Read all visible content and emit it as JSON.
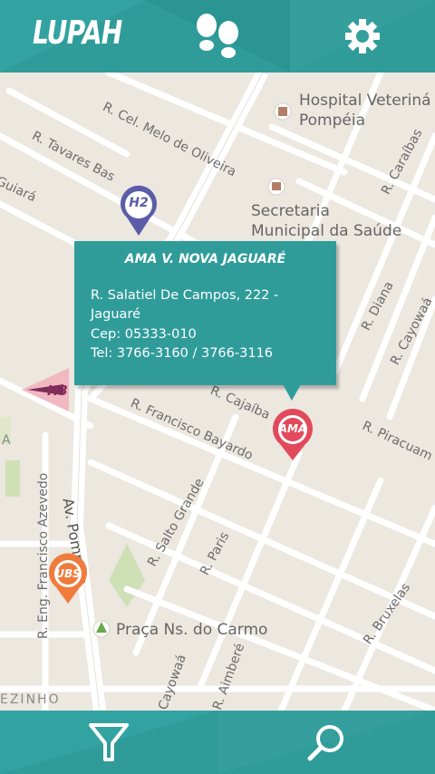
{
  "app": {
    "title": "LUPAH"
  },
  "header": {
    "steps_icon": "footsteps-icon",
    "settings_icon": "gear-icon"
  },
  "map": {
    "streets": [
      "R. Cel. Melo de Oliveira",
      "R. Tavares Bas",
      "Guiará",
      "R. Caraíbas",
      "R. Diana",
      "R. Cayowaá",
      "R. Francisco Bayardo",
      "R. Cajaíba",
      "R. Piracuam",
      "R. Salto Grande",
      "R. Paris",
      "Av. Pompéia",
      "R. Eng. Francisco Azevedo",
      "R. Bruxelas",
      "R. Aimberé",
      "Cayowaá",
      "EZINHO",
      "A"
    ],
    "pois": {
      "hospital": "Hospital Veterinário Pompéia",
      "hospital_line1": "Hospital Veteriná",
      "hospital_line2": "Pompéia",
      "secretaria_line1": "Secretaria",
      "secretaria_line2": "Municipal da Saúde",
      "praca": "Praça Ns. do Carmo"
    },
    "markers": {
      "h2": "H2",
      "h3": "H3",
      "ama": "AMA",
      "ubs": "UBS"
    }
  },
  "popup": {
    "title": "AMA V. NOVA JAGUARÉ",
    "address_line1": "R. Salatiel De Campos, 222 -",
    "address_line2": "Jaguaré",
    "cep": "Cep: 05333-010",
    "tel": "Tel: 3766-3160 / 3766-3116"
  },
  "bottom": {
    "filter_icon": "filter-icon",
    "search_icon": "search-icon"
  },
  "colors": {
    "teal": "#2f9c9a",
    "ama_red": "#e24a5c",
    "ubs_orange": "#ef7b3c",
    "h2_purple": "#5b5da8",
    "h3_pink": "#f2b8c2"
  }
}
